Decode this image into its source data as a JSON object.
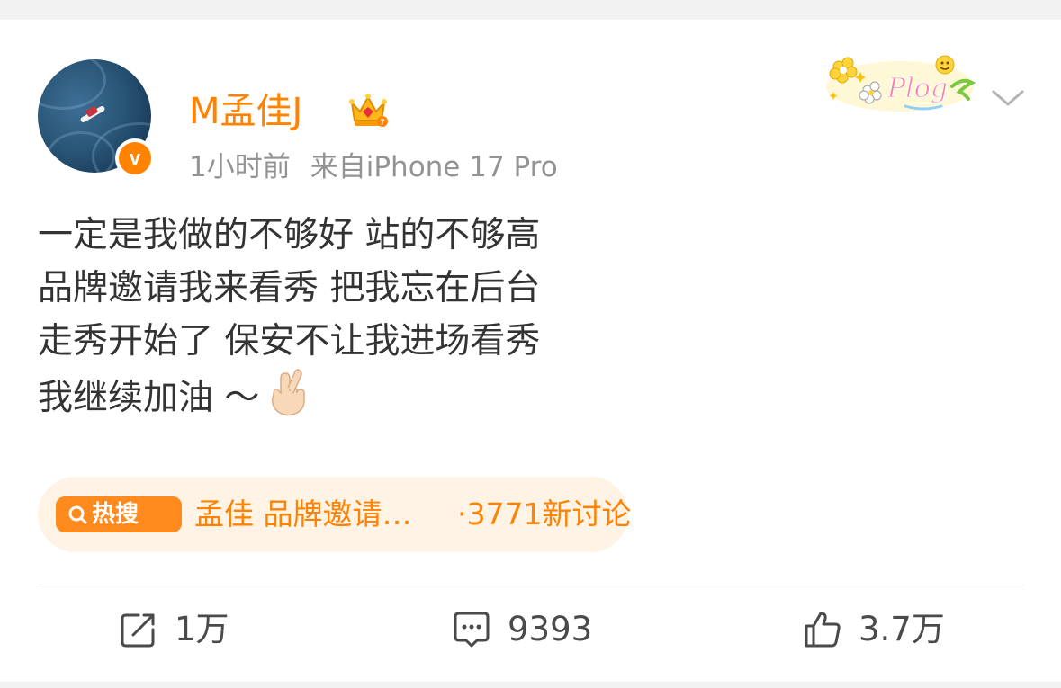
{
  "post": {
    "author": {
      "name": "M孟佳J",
      "verified_mark": "v",
      "icons": [
        "avatar",
        "verified-badge-icon",
        "crown-icon"
      ]
    },
    "time": "1小时前",
    "source": "来自iPhone 17 Pro",
    "text_lines": [
      "一定是我做的不够好 站的不够高",
      "品牌邀请我来看秀 把我忘在后台",
      "走秀开始了 保安不让我进场看秀",
      "我继续加油 ～"
    ],
    "sticker_text": "Plog",
    "hot_search": {
      "badge": "热搜",
      "title": "孟佳 品牌邀请…",
      "count": "·3771新讨论"
    },
    "actions": {
      "repost": "1万",
      "comment": "9393",
      "like": "3.7万"
    }
  },
  "colors": {
    "accent": "#ff8200",
    "text": "#333333",
    "meta": "#939393",
    "pill_bg": "#fff3e6"
  }
}
